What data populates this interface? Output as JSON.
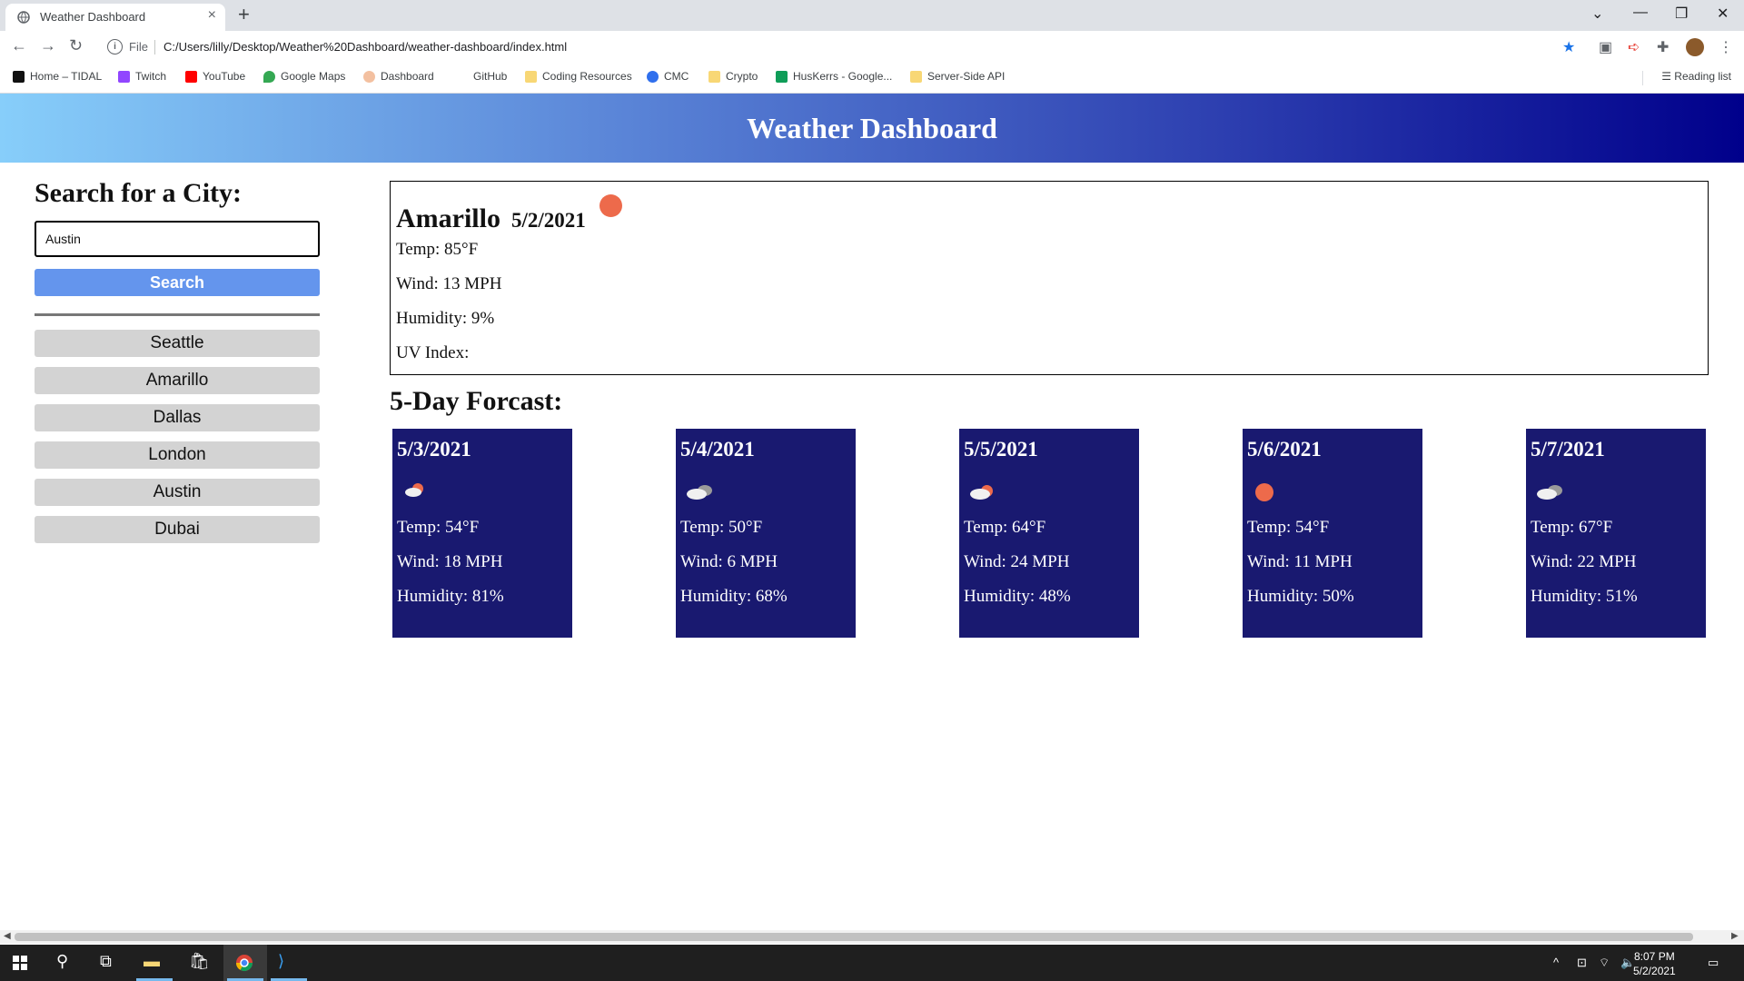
{
  "browser": {
    "tab_title": "Weather Dashboard",
    "address_scheme": "File",
    "url": "C:/Users/lilly/Desktop/Weather%20Dashboard/weather-dashboard/index.html",
    "bookmarks": [
      "Home – TIDAL",
      "Twitch",
      "YouTube",
      "Google Maps",
      "Dashboard",
      "GitHub",
      "Coding Resources",
      "CMC",
      "Crypto",
      "HusKerrs - Google...",
      "Server-Side API"
    ],
    "reading_list": "Reading list"
  },
  "header": {
    "title": "Weather Dashboard"
  },
  "search": {
    "heading": "Search for a City:",
    "input_value": "Austin",
    "button_label": "Search",
    "history": [
      "Seattle",
      "Amarillo",
      "Dallas",
      "London",
      "Austin",
      "Dubai"
    ]
  },
  "current": {
    "city": "Amarillo",
    "date": "5/2/2021",
    "icon": "clear-sun-icon",
    "temp": "Temp: 85°F",
    "wind": "Wind: 13 MPH",
    "humidity": "Humidity: 9%",
    "uv": "UV Index:"
  },
  "forecast": {
    "heading": "5-Day Forcast:",
    "days": [
      {
        "date": "5/3/2021",
        "icon": "few-clouds-icon",
        "temp": "Temp: 54°F",
        "wind": "Wind: 18 MPH",
        "humidity": "Humidity: 81%"
      },
      {
        "date": "5/4/2021",
        "icon": "broken-clouds-icon",
        "temp": "Temp: 50°F",
        "wind": "Wind: 6 MPH",
        "humidity": "Humidity: 68%"
      },
      {
        "date": "5/5/2021",
        "icon": "few-clouds-icon",
        "temp": "Temp: 64°F",
        "wind": "Wind: 24 MPH",
        "humidity": "Humidity: 48%"
      },
      {
        "date": "5/6/2021",
        "icon": "clear-sun-icon",
        "temp": "Temp: 54°F",
        "wind": "Wind: 11 MPH",
        "humidity": "Humidity: 50%"
      },
      {
        "date": "5/7/2021",
        "icon": "broken-clouds-icon",
        "temp": "Temp: 67°F",
        "wind": "Wind: 22 MPH",
        "humidity": "Humidity: 51%"
      }
    ]
  },
  "taskbar": {
    "time": "8:07 PM",
    "date": "5/2/2021"
  },
  "colors": {
    "banner_start": "#87cefa",
    "banner_end": "#00008b",
    "search_button": "#6495ed",
    "history_button": "#d3d3d3",
    "forecast_card": "#191970",
    "sun": "#ed6a4b"
  }
}
